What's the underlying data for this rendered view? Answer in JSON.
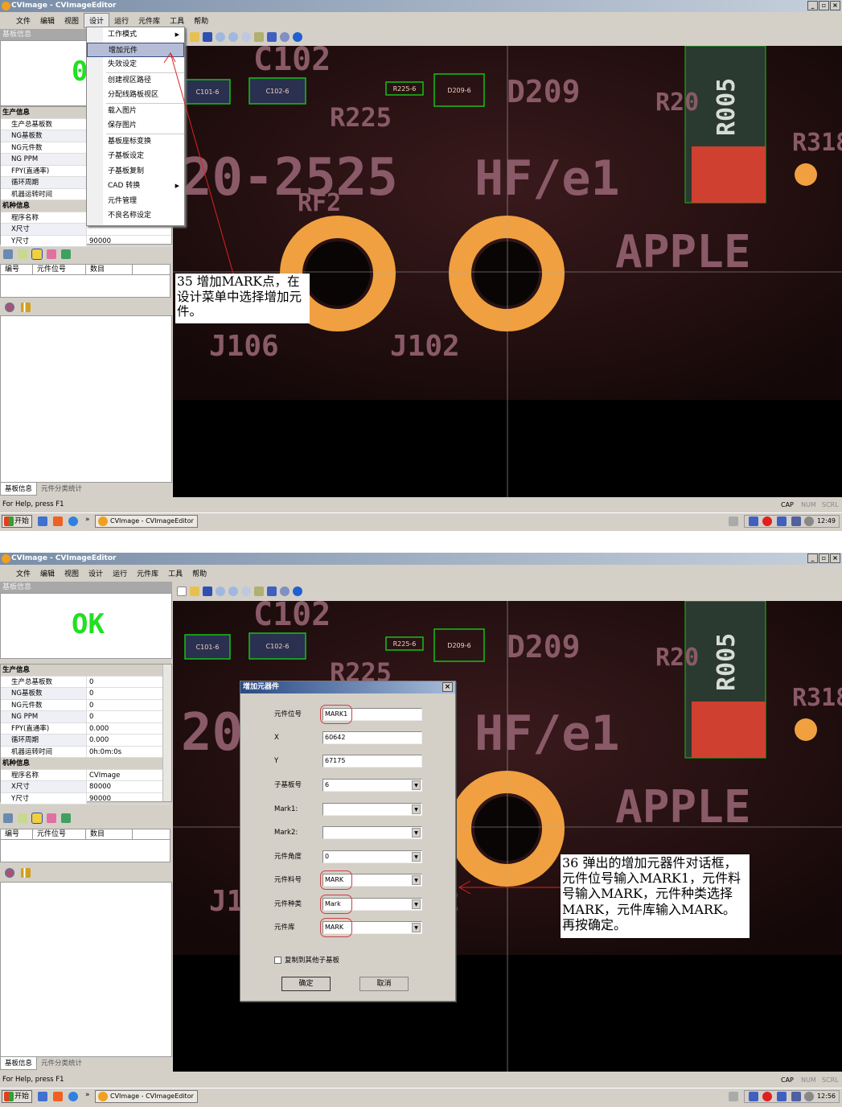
{
  "window": {
    "title": "CVImage - CVImageEditor",
    "min": "_",
    "max": "▫",
    "close": "×"
  },
  "menus": [
    "文件",
    "编辑",
    "视图",
    "设计",
    "运行",
    "元件库",
    "工具",
    "帮助"
  ],
  "panel": {
    "header": "基板信息",
    "prod_section": "生产信息",
    "prod_rows": [
      "生产总基板数",
      "NG基板数",
      "NG元件数",
      "NG PPM",
      "FPY(直通率)",
      "循环周期",
      "机器运转时间"
    ],
    "model_section": "机种信息",
    "model_rows": [
      "程序名称",
      "X尺寸",
      "Y尺寸"
    ],
    "list_headers": [
      "编号",
      "元件位号",
      "数目"
    ],
    "tabs": [
      "基板信息",
      "元件分类统计"
    ]
  },
  "shot1": {
    "ok_text": "0",
    "model_values": [
      "",
      "",
      "90000"
    ],
    "annotation": "35 增加MARK点，在设计菜单中选择增加元件。",
    "clock": "12:49"
  },
  "shot2": {
    "ok_text": "OK",
    "prod_values": [
      "0",
      "0",
      "0",
      "0",
      "0.000",
      "0.000",
      "0h:0m:0s"
    ],
    "model_values": [
      "CVImage",
      "80000",
      "90000"
    ],
    "annotation": "36 弹出的增加元器件对话框，元件位号输入MARK1，元件料号输入MARK，元件种类选择MARK，元件库输入MARK。再按确定。",
    "clock": "12:56"
  },
  "design_menu": {
    "items": [
      "工作模式",
      "增加元件",
      "失效设定",
      "创建视区路径",
      "分配线路板视区",
      "载入图片",
      "保存图片",
      "基板座标变换",
      "子基板设定",
      "子基板复制",
      "CAD 转换",
      "元件管理",
      "不良名称设定"
    ],
    "highlighted": "增加元件"
  },
  "components": [
    "C101-6",
    "C102-6",
    "R225-6",
    "D209-6"
  ],
  "pcb_text": {
    "a": "20-2525",
    "b": "HF/e1",
    "c": "APPLE",
    "d": "J106",
    "e": "J102",
    "f": "D209",
    "g": "R005",
    "h": "R318",
    "i": "C102",
    "j": "R225",
    "k": "RF2",
    "l": "R20"
  },
  "status": {
    "help": "For Help, press F1",
    "cap": "CAP",
    "num": "NUM",
    "scrl": "SCRL"
  },
  "taskbar": {
    "start": "开始",
    "task": "CVImage - CVImageEditor",
    "chevron": "»"
  },
  "dialog": {
    "title": "增加元器件",
    "fields": [
      {
        "label": "元件位号",
        "value": "MARK1"
      },
      {
        "label": "X",
        "value": "60642"
      },
      {
        "label": "Y",
        "value": "67175"
      },
      {
        "label": "子基板号",
        "value": "6"
      },
      {
        "label": "Mark1:",
        "value": ""
      },
      {
        "label": "Mark2:",
        "value": ""
      },
      {
        "label": "元件角度",
        "value": "0"
      },
      {
        "label": "元件料号",
        "value": "MARK"
      },
      {
        "label": "元件种类",
        "value": "Mark"
      },
      {
        "label": "元件库",
        "value": "MARK"
      }
    ],
    "checkbox_label": "复制到其他子基板",
    "ok": "确定",
    "cancel": "取消"
  },
  "colors": {
    "ok_green": "#21e021",
    "box_green": "#16c016",
    "pad_orange": "#f0a040",
    "annotation_red": "#e02020"
  }
}
